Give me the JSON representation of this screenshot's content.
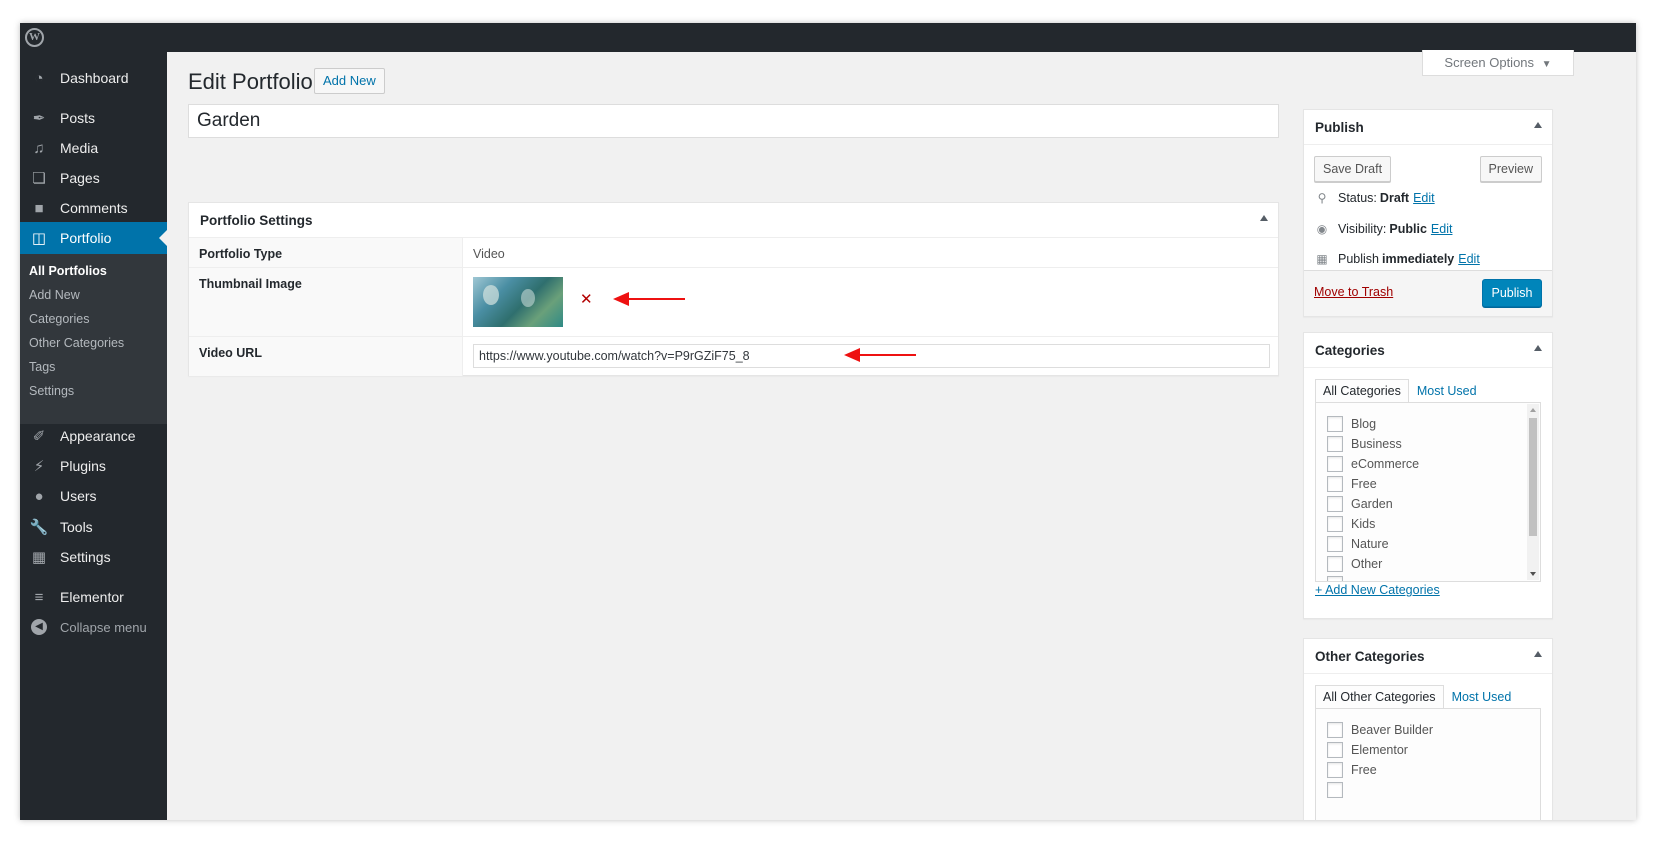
{
  "admin_bar": {
    "logo": "W"
  },
  "sidebar": {
    "items": [
      {
        "label": "Dashboard",
        "icon": "dashboard-icon"
      },
      {
        "label": "Posts",
        "icon": "pin-icon"
      },
      {
        "label": "Media",
        "icon": "media-icon"
      },
      {
        "label": "Pages",
        "icon": "pages-icon"
      },
      {
        "label": "Comments",
        "icon": "comment-icon"
      },
      {
        "label": "Portfolio",
        "icon": "folder-icon"
      },
      {
        "label": "Appearance",
        "icon": "brush-icon"
      },
      {
        "label": "Plugins",
        "icon": "plugin-icon"
      },
      {
        "label": "Users",
        "icon": "user-icon"
      },
      {
        "label": "Tools",
        "icon": "wrench-icon"
      },
      {
        "label": "Settings",
        "icon": "settings-icon"
      },
      {
        "label": "Elementor",
        "icon": "elementor-icon"
      },
      {
        "label": "Collapse menu",
        "icon": "collapse-icon"
      }
    ],
    "submenu": [
      "All Portfolios",
      "Add New",
      "Categories",
      "Other Categories",
      "Tags",
      "Settings"
    ]
  },
  "header": {
    "title": "Edit Portfolio",
    "add_new": "Add New",
    "screen_options": "Screen Options"
  },
  "post": {
    "title": "Garden"
  },
  "portfolio_settings": {
    "title": "Portfolio Settings",
    "type_label": "Portfolio Type",
    "type_value": "Video",
    "thumbnail_label": "Thumbnail Image",
    "remove_icon": "close-icon",
    "video_label": "Video URL",
    "video_url": "https://www.youtube.com/watch?v=P9rGZiF75_8"
  },
  "publish": {
    "title": "Publish",
    "save_draft": "Save Draft",
    "preview": "Preview",
    "status_label": "Status:",
    "status_value": "Draft",
    "visibility_label": "Visibility:",
    "visibility_value": "Public",
    "publish_label": "Publish",
    "publish_value": "immediately",
    "edit": "Edit",
    "trash": "Move to Trash",
    "publish_button": "Publish"
  },
  "categories": {
    "title": "Categories",
    "tabs": [
      "All Categories",
      "Most Used"
    ],
    "items": [
      "Blog",
      "Business",
      "eCommerce",
      "Free",
      "Garden",
      "Kids",
      "Nature",
      "Other"
    ],
    "add_new": "+ Add New Categories"
  },
  "other_categories": {
    "title": "Other Categories",
    "tabs": [
      "All Other Categories",
      "Most Used"
    ],
    "items": [
      "Beaver Builder",
      "Elementor",
      "Free"
    ]
  },
  "colors": {
    "accent": "#0073aa",
    "sidebar": "#23282d",
    "annotation_arrow": "#ee1111"
  }
}
